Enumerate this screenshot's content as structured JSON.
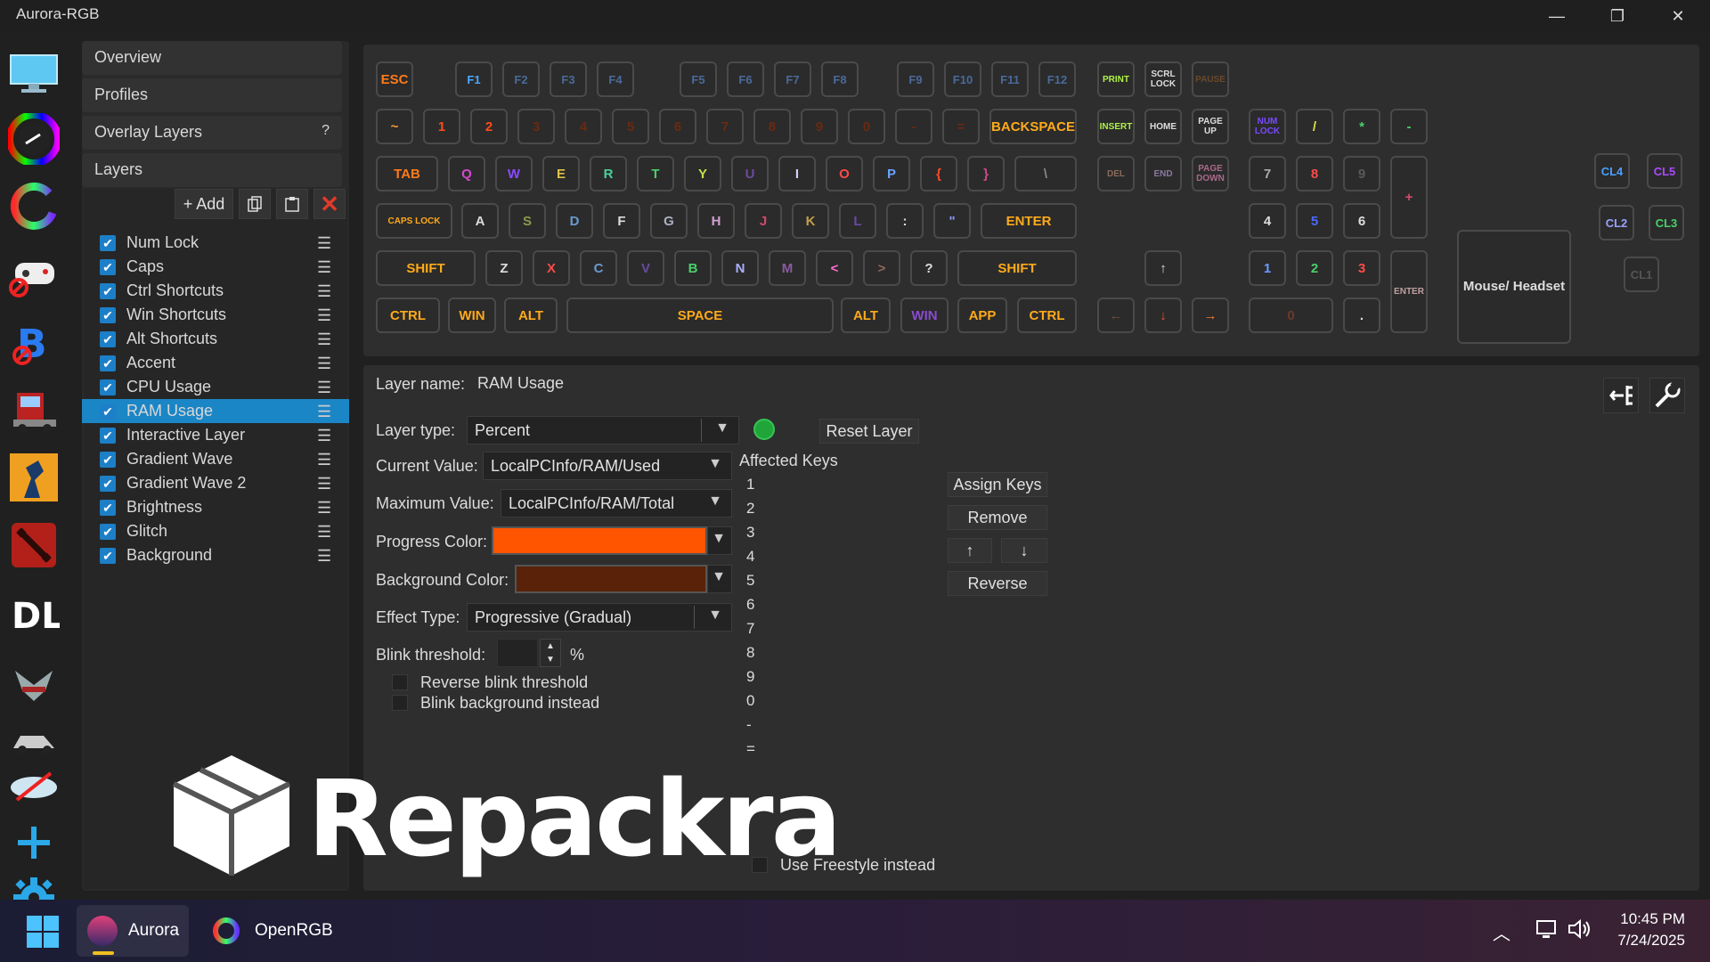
{
  "window": {
    "title": "Aurora-RGB",
    "minimize": "—",
    "maximize": "❐",
    "close": "✕"
  },
  "iconbar": {
    "items": [
      "desktop-icon",
      "color-wheel-icon",
      "openrgb-icon",
      "gamepad-disabled-icon",
      "b3-icon",
      "truck-icon",
      "counter-strike-icon",
      "dota-icon",
      "dying-light-icon",
      "elite-icon",
      "car-icon",
      "disabled-icon",
      "add-icon",
      "settings-icon"
    ]
  },
  "sidebar": {
    "nav": [
      "Overview",
      "Profiles",
      "Overlay Layers",
      "Layers"
    ],
    "overlay_help": "?",
    "toolbar": {
      "add": "Add"
    },
    "layers": [
      {
        "label": "Num Lock",
        "checked": true
      },
      {
        "label": "Caps",
        "checked": true
      },
      {
        "label": "Ctrl Shortcuts",
        "checked": true
      },
      {
        "label": "Win Shortcuts",
        "checked": true
      },
      {
        "label": "Alt Shortcuts",
        "checked": true
      },
      {
        "label": "Accent",
        "checked": true
      },
      {
        "label": "CPU Usage",
        "checked": true
      },
      {
        "label": "RAM Usage",
        "checked": true,
        "selected": true
      },
      {
        "label": "Interactive Layer",
        "checked": true
      },
      {
        "label": "Gradient Wave",
        "checked": true
      },
      {
        "label": "Gradient Wave 2",
        "checked": true
      },
      {
        "label": "Brightness",
        "checked": true
      },
      {
        "label": "Glitch",
        "checked": true
      },
      {
        "label": "Background",
        "checked": true
      }
    ]
  },
  "keyboard": {
    "row_fn": [
      "ESC",
      "F1",
      "F2",
      "F3",
      "F4",
      "F5",
      "F6",
      "F7",
      "F8",
      "F9",
      "F10",
      "F11",
      "F12",
      "PRINT",
      "SCRL LOCK",
      "PAUSE"
    ],
    "row_num": [
      "~",
      "1",
      "2",
      "3",
      "4",
      "5",
      "6",
      "7",
      "8",
      "9",
      "0",
      "-",
      "=",
      "BACKSPACE",
      "INSERT",
      "HOME",
      "PAGE UP",
      "NUM LOCK",
      "/",
      "*",
      "-"
    ],
    "row_tab": [
      "TAB",
      "Q",
      "W",
      "E",
      "R",
      "T",
      "Y",
      "U",
      "I",
      "O",
      "P",
      "{",
      "}",
      "\\",
      "DEL",
      "END",
      "PAGE DOWN",
      "7",
      "8",
      "9",
      "+"
    ],
    "row_caps": [
      "CAPS LOCK",
      "A",
      "S",
      "D",
      "F",
      "G",
      "H",
      "J",
      "K",
      "L",
      ":",
      "\"",
      "ENTER",
      "4",
      "5",
      "6"
    ],
    "row_shift": [
      "SHIFT",
      "Z",
      "X",
      "C",
      "V",
      "B",
      "N",
      "M",
      "<",
      ">",
      "?",
      "SHIFT",
      "↑",
      "1",
      "2",
      "3",
      "ENTER"
    ],
    "row_ctrl": [
      "CTRL",
      "WIN",
      "ALT",
      "SPACE",
      "ALT",
      "WIN",
      "APP",
      "CTRL",
      "←",
      "↓",
      "→",
      "0",
      "."
    ],
    "extra": [
      "CL4",
      "CL5",
      "CL2",
      "CL3",
      "CL1",
      "Mouse/ Headset"
    ]
  },
  "props": {
    "layer_name_label": "Layer name:",
    "layer_name_value": "RAM Usage",
    "layer_type_label": "Layer type:",
    "layer_type_value": "Percent",
    "reset_layer": "Reset Layer",
    "current_value_label": "Current Value:",
    "current_value": "LocalPCInfo/RAM/Used",
    "max_value_label": "Maximum Value:",
    "max_value": "LocalPCInfo/RAM/Total",
    "progress_color_label": "Progress Color:",
    "progress_color": "#ff5500",
    "background_color_label": "Background Color:",
    "background_color": "#5a2208",
    "effect_type_label": "Effect Type:",
    "effect_type_value": "Progressive (Gradual)",
    "blink_threshold_label": "Blink threshold:",
    "blink_unit": "%",
    "reverse_blink": "Reverse blink threshold",
    "blink_background": "Blink background instead",
    "affected_keys_label": "Affected Keys",
    "affected_keys": [
      "1",
      "2",
      "3",
      "4",
      "5",
      "6",
      "7",
      "8",
      "9",
      "0",
      "-",
      "="
    ],
    "assign_keys": "Assign Keys",
    "remove": "Remove",
    "up": "↑",
    "down": "↓",
    "reverse": "Reverse",
    "use_freestyle": "Use Freestyle instead"
  },
  "taskbar": {
    "apps": [
      {
        "label": "Aurora"
      },
      {
        "label": "OpenRGB"
      }
    ],
    "time": "10:45 PM",
    "date": "7/24/2025"
  },
  "watermark": {
    "text": "Repackra"
  },
  "colors": {
    "accent": "#1b86c6",
    "selected_row": "#1b86c6",
    "close_x": "#e03a2a"
  }
}
